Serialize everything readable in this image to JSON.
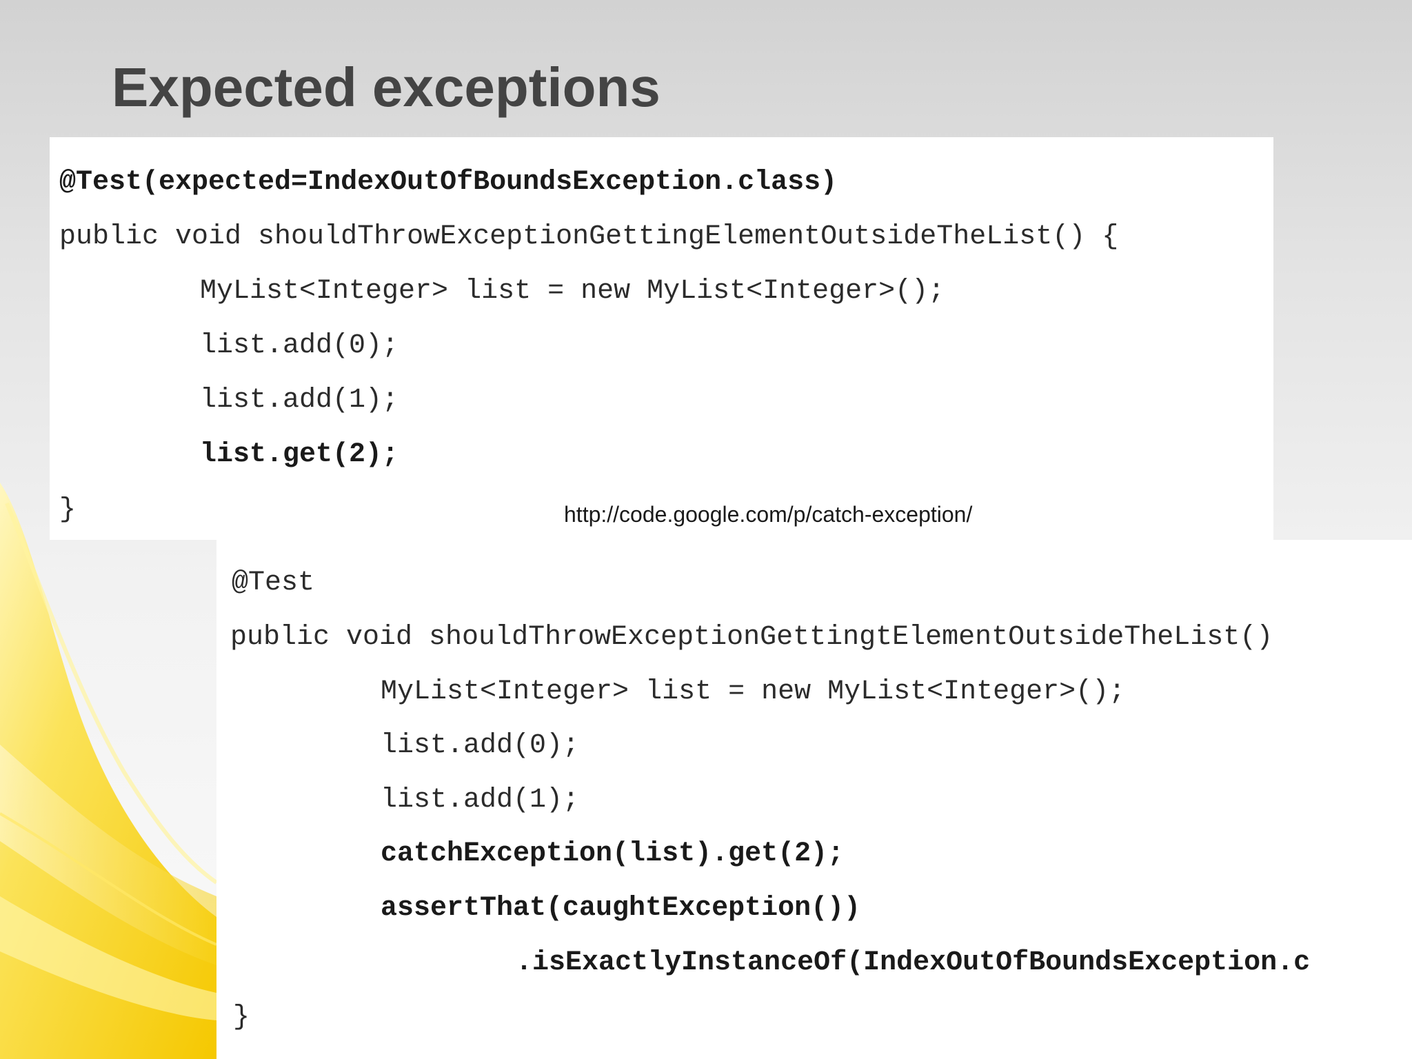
{
  "title": "Expected exceptions",
  "link_url_text": "http://code.google.com/p/catch-exception/",
  "colors": {
    "title": "#444444",
    "accent_yellow": "#f7d61a",
    "code_text": "#2b2b2b",
    "code_background": "#ffffff"
  },
  "code_block_1": {
    "lines": [
      "@Test(expected=IndexOutOfBoundsException.class)",
      "public void shouldThrowExceptionGettingElementOutsideTheList() {",
      "MyList<Integer> list = new MyList<Integer>();",
      "list.add(0);",
      "list.add(1);",
      "list.get(2);",
      "}"
    ]
  },
  "code_block_2": {
    "lines": [
      "@Test",
      "public void shouldThrowExceptionGettingtElementOutsideTheList()",
      "MyList<Integer> list = new MyList<Integer>();",
      "list.add(0);",
      "list.add(1);",
      "catchException(list).get(2);",
      "assertThat(caughtException())",
      ".isExactlyInstanceOf(IndexOutOfBoundsException.c",
      "}"
    ]
  }
}
